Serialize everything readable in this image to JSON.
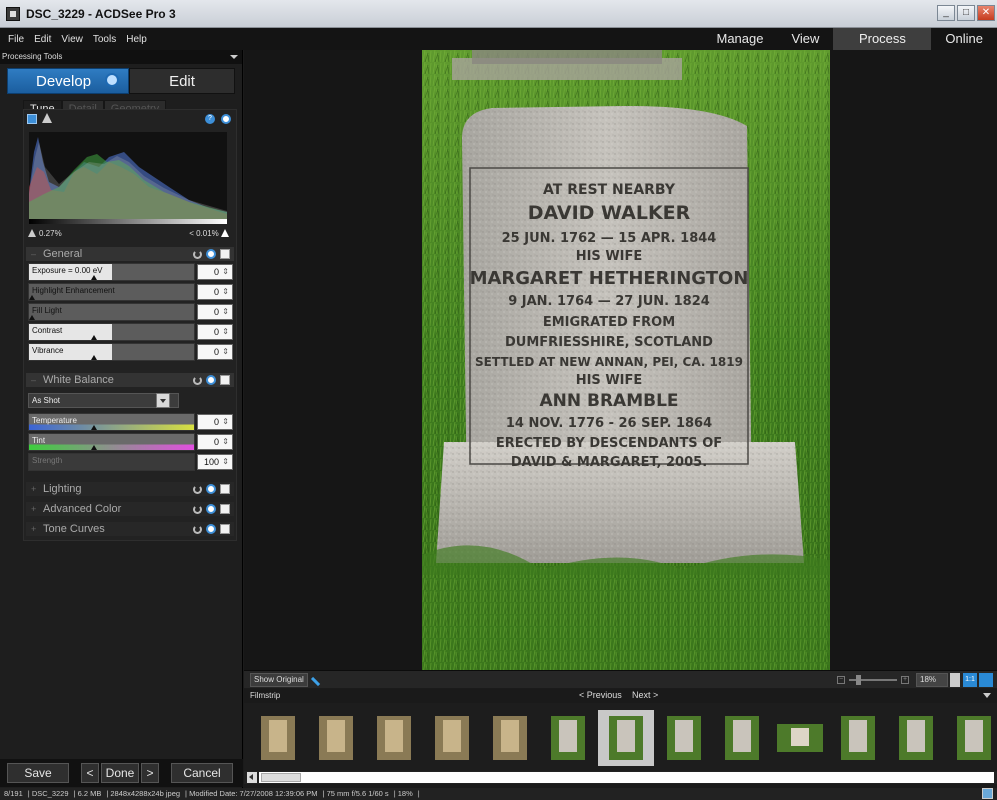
{
  "window": {
    "title": "DSC_3229 - ACDSee Pro 3",
    "controls": [
      "_",
      "□",
      "✕"
    ]
  },
  "menu": {
    "items": [
      "File",
      "Edit",
      "View",
      "Tools",
      "Help"
    ],
    "modes": [
      "Manage",
      "View",
      "Process",
      "Online"
    ],
    "active_mode": "Process"
  },
  "left_panel": {
    "header": "Processing Tools",
    "develop_label": "Develop",
    "edit_label": "Edit",
    "tabs": [
      "Tune",
      "Detail",
      "Geometry"
    ],
    "active_tab": "Tune",
    "histogram": {
      "shadow_clip": "0.27%",
      "highlight_clip": "< 0.01%",
      "help_glyph": "?"
    },
    "general": {
      "title": "General",
      "sliders": [
        {
          "label": "Exposure = 0.00 eV",
          "value": "0",
          "level": 0.5
        },
        {
          "label": "Highlight Enhancement",
          "value": "0",
          "level": 0.0
        },
        {
          "label": "Fill Light",
          "value": "0",
          "level": 0.0
        },
        {
          "label": "Contrast",
          "value": "0",
          "level": 0.5
        },
        {
          "label": "Vibrance",
          "value": "0",
          "level": 0.5
        }
      ]
    },
    "white_balance": {
      "title": "White Balance",
      "preset": "As Shot",
      "sliders": [
        {
          "label": "Temperature",
          "value": "0"
        },
        {
          "label": "Tint",
          "value": "0"
        },
        {
          "label": "Strength",
          "value": "100"
        }
      ]
    },
    "collapsed_groups": [
      "Lighting",
      "Advanced Color",
      "Tone Curves"
    ],
    "buttons": {
      "save": "Save",
      "prev": "<",
      "done": "Done",
      "next": ">",
      "cancel": "Cancel"
    }
  },
  "headstone": {
    "lines": [
      "AT REST NEARBY",
      "DAVID WALKER",
      "25 JUN. 1762  —  15 APR. 1844",
      "HIS WIFE",
      "MARGARET HETHERINGTON",
      "9 JAN. 1764  —  27 JUN. 1824",
      "EMIGRATED FROM",
      "DUMFRIESSHIRE, SCOTLAND",
      "SETTLED AT NEW ANNAN, PEI, CA. 1819",
      "HIS WIFE",
      "ANN BRAMBLE",
      "14 NOV. 1776 - 26 SEP. 1864",
      "ERECTED BY DESCENDANTS OF",
      "DAVID & MARGARET, 2005."
    ]
  },
  "view_bar": {
    "show_original": "Show Original",
    "zoom_minus": "−",
    "zoom_plus": "+",
    "zoom": "18%",
    "view_btn": "1:1"
  },
  "filmstrip": {
    "title": "Filmstrip",
    "previous": "< Previous",
    "next": "Next >",
    "thumb_count": 13,
    "selected_index": 6
  },
  "status": {
    "items": [
      "8/191",
      "DSC_3229",
      "6.2 MB",
      "2848x4288x24b jpeg",
      "Modified Date: 7/27/2008 12:39:06 PM",
      "75 mm  f/5.6  1/60 s",
      "18%"
    ]
  },
  "colors": {
    "accent": "#2a7bc4",
    "background": "#1b1b1b",
    "grass": "#3f7d1f",
    "stone": "#b9b6b0"
  }
}
